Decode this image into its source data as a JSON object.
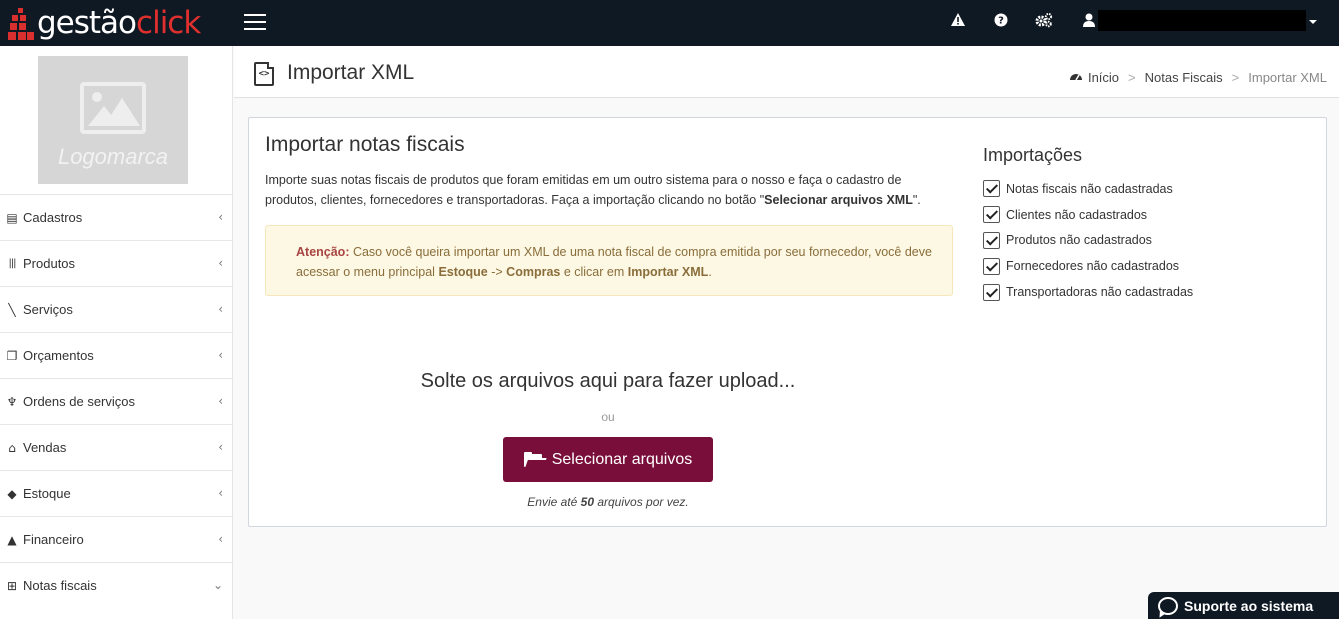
{
  "app": {
    "logo_part1": "gestão",
    "logo_part2": "click",
    "brand_color": "#e0302e",
    "topbar_color": "#0f1923"
  },
  "topbar": {
    "icons": [
      "warning-icon",
      "help-icon",
      "settings-cogs-icon",
      "user-icon"
    ],
    "warning_glyph": "⚠",
    "help_glyph": "?",
    "settings_glyph": "⚙",
    "user_glyph": "👤"
  },
  "sidebar": {
    "logomarca_label": "Logomarca",
    "items": [
      {
        "label": "Cadastros",
        "icon": "list-icon",
        "glyph": "▤",
        "arrow": "‹"
      },
      {
        "label": "Produtos",
        "icon": "barcode-icon",
        "glyph": "|||",
        "arrow": "‹"
      },
      {
        "label": "Serviços",
        "icon": "wrench-icon",
        "glyph": "╲",
        "arrow": "‹"
      },
      {
        "label": "Orçamentos",
        "icon": "copy-icon",
        "glyph": "❐",
        "arrow": "‹"
      },
      {
        "label": "Ordens de serviços",
        "icon": "trophy-icon",
        "glyph": "♆",
        "arrow": "‹"
      },
      {
        "label": "Vendas",
        "icon": "basket-icon",
        "glyph": "⌂",
        "arrow": "‹"
      },
      {
        "label": "Estoque",
        "icon": "cube-icon",
        "glyph": "◆",
        "arrow": "‹"
      },
      {
        "label": "Financeiro",
        "icon": "money-bag-icon",
        "glyph": "▲",
        "arrow": "‹"
      },
      {
        "label": "Notas fiscais",
        "icon": "sitemap-icon",
        "glyph": "⊞",
        "arrow": "⌄"
      }
    ]
  },
  "header": {
    "title": "Importar XML",
    "breadcrumb": {
      "home": "Início",
      "section": "Notas Fiscais",
      "current": "Importar XML",
      "separator": ">"
    }
  },
  "main": {
    "title": "Importar notas fiscais",
    "desc_part1": "Importe suas notas fiscais de produtos que foram emitidas em um outro sistema para o nosso e faça o cadastro de produtos, clientes, fornecedores e transportadoras. Faça a importação clicando no botão \"",
    "desc_bold": "Selecionar arquivos XML",
    "desc_part2": "\".",
    "alert": {
      "label": "Atenção:",
      "text1": " Caso você queira importar um XML de uma nota fiscal de compra emitida por seu fornecedor, você deve acessar o menu principal ",
      "bold1": "Estoque",
      "text2": " -> ",
      "bold2": "Compras",
      "text3": " e clicar em ",
      "bold3": "Importar XML",
      "text4": "."
    },
    "importacoes": {
      "title": "Importações",
      "items": [
        {
          "label": "Notas fiscais não cadastradas",
          "checked": true
        },
        {
          "label": "Clientes não cadastrados",
          "checked": true
        },
        {
          "label": "Produtos não cadastrados",
          "checked": true
        },
        {
          "label": "Fornecedores não cadastrados",
          "checked": true
        },
        {
          "label": "Transportadoras não cadastradas",
          "checked": true
        }
      ]
    },
    "upload": {
      "drop_text": "Solte os arquivos aqui para fazer upload...",
      "or_text": "ou",
      "button_label": "Selecionar arquivos",
      "button_color": "#7a0e3b",
      "limit_prefix": "Envie até ",
      "limit_count": "50",
      "limit_suffix": " arquivos por vez."
    }
  },
  "support": {
    "label": "Suporte ao sistema"
  }
}
